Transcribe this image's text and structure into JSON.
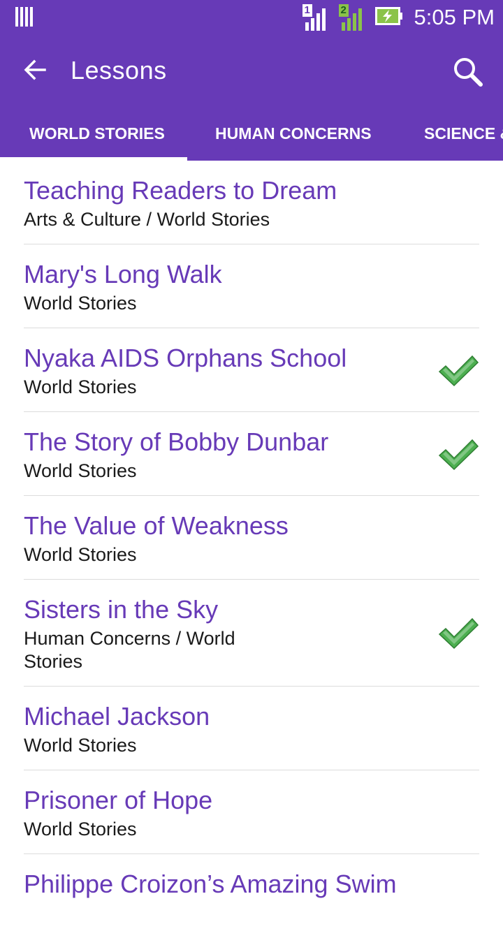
{
  "status_bar": {
    "time": "5:05 PM",
    "sim1_label": "1",
    "sim2_label": "2",
    "icons": [
      "notification-bars-icon",
      "signal-sim1-icon",
      "signal-sim2-icon",
      "battery-charging-icon"
    ]
  },
  "app_bar": {
    "title": "Lessons",
    "back_icon": "arrow-left-icon",
    "search_icon": "search-icon"
  },
  "tabs": [
    {
      "label": "WORLD STORIES",
      "selected": true
    },
    {
      "label": "HUMAN CONCERNS",
      "selected": false
    },
    {
      "label": "SCIENCE &",
      "selected": false
    }
  ],
  "lessons": [
    {
      "title": "Teaching Readers to Dream",
      "category": "Arts & Culture / World Stories",
      "completed": false
    },
    {
      "title": "Mary's Long Walk",
      "category": "World Stories",
      "completed": false
    },
    {
      "title": "Nyaka AIDS Orphans School",
      "category": "World Stories",
      "completed": true
    },
    {
      "title": "The Story of Bobby Dunbar",
      "category": "World Stories",
      "completed": true
    },
    {
      "title": "The Value of Weakness",
      "category": "World Stories",
      "completed": false
    },
    {
      "title": "Sisters in the Sky",
      "category": "Human Concerns / World Stories",
      "completed": true
    },
    {
      "title": "Michael Jackson",
      "category": "World Stories",
      "completed": false
    },
    {
      "title": "Prisoner of Hope",
      "category": "World Stories",
      "completed": false
    },
    {
      "title": "Philippe Croizon’s Amazing Swim",
      "category": "",
      "completed": false
    }
  ],
  "colors": {
    "primary": "#673ab7",
    "title_text": "#673ab7",
    "check_green": "#4caf50"
  }
}
